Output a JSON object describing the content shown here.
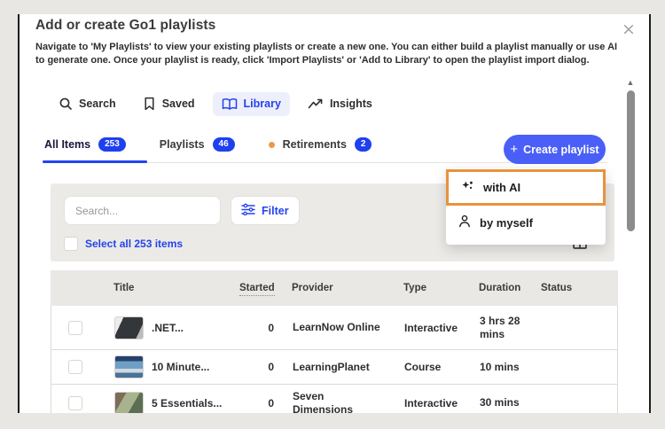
{
  "modal": {
    "title": "Add or create Go1 playlists",
    "description": "Navigate to 'My Playlists' to view your existing playlists or create a new one. You can either build a playlist manually or use AI to generate one. Once your playlist is ready, click 'Import Playlists' or 'Add to Library' to open the playlist import dialog.",
    "close_glyph": "×"
  },
  "nav": {
    "items": [
      {
        "label": "Search",
        "icon": "search-icon",
        "active": false
      },
      {
        "label": "Saved",
        "icon": "bookmark-icon",
        "active": false
      },
      {
        "label": "Library",
        "icon": "open-book-icon",
        "active": true
      },
      {
        "label": "Insights",
        "icon": "trend-arrow-icon",
        "active": false
      }
    ]
  },
  "tabs": [
    {
      "label": "All Items",
      "count": "253",
      "active": true
    },
    {
      "label": "Playlists",
      "count": "46",
      "active": false
    },
    {
      "label": "Retirements",
      "count": "2",
      "active": false,
      "dot_color": "#eb9a47"
    }
  ],
  "create": {
    "button_label": "Create playlist",
    "plus_glyph": "+",
    "menu": [
      {
        "label": "with AI",
        "icon": "ai-sparkle-icon",
        "highlighted": true
      },
      {
        "label": "by myself",
        "icon": "person-icon",
        "highlighted": false
      }
    ]
  },
  "toolbar": {
    "search_placeholder": "Search...",
    "filter_label": "Filter",
    "select_all_label": "Select all 253 items"
  },
  "table": {
    "columns": [
      "Title",
      "Started",
      "Provider",
      "Type",
      "Duration",
      "Status"
    ],
    "rows": [
      {
        "title": ".NET...",
        "started": "0",
        "provider": "LearnNow Online",
        "type": "Interactive",
        "duration": "3 hrs 28 mins",
        "status": "",
        "thumb": "computer-screen"
      },
      {
        "title": "10 Minute...",
        "started": "0",
        "provider": "LearningPlanet",
        "type": "Course",
        "duration": "10 mins",
        "status": "",
        "thumb": "classroom-collage"
      },
      {
        "title": "5 Essentials...",
        "started": "0",
        "provider": "Seven Dimensions",
        "type": "Interactive",
        "duration": "30 mins",
        "status": "",
        "thumb": "office-people"
      }
    ]
  },
  "scrollbar": {
    "up_glyph": "▲"
  },
  "colors": {
    "accent_blue": "#2443ee",
    "button_blue": "#4a5ff7",
    "highlight_orange": "#e8923b",
    "retirement_dot": "#eb9a47",
    "page_background": "#e9e7e3"
  }
}
